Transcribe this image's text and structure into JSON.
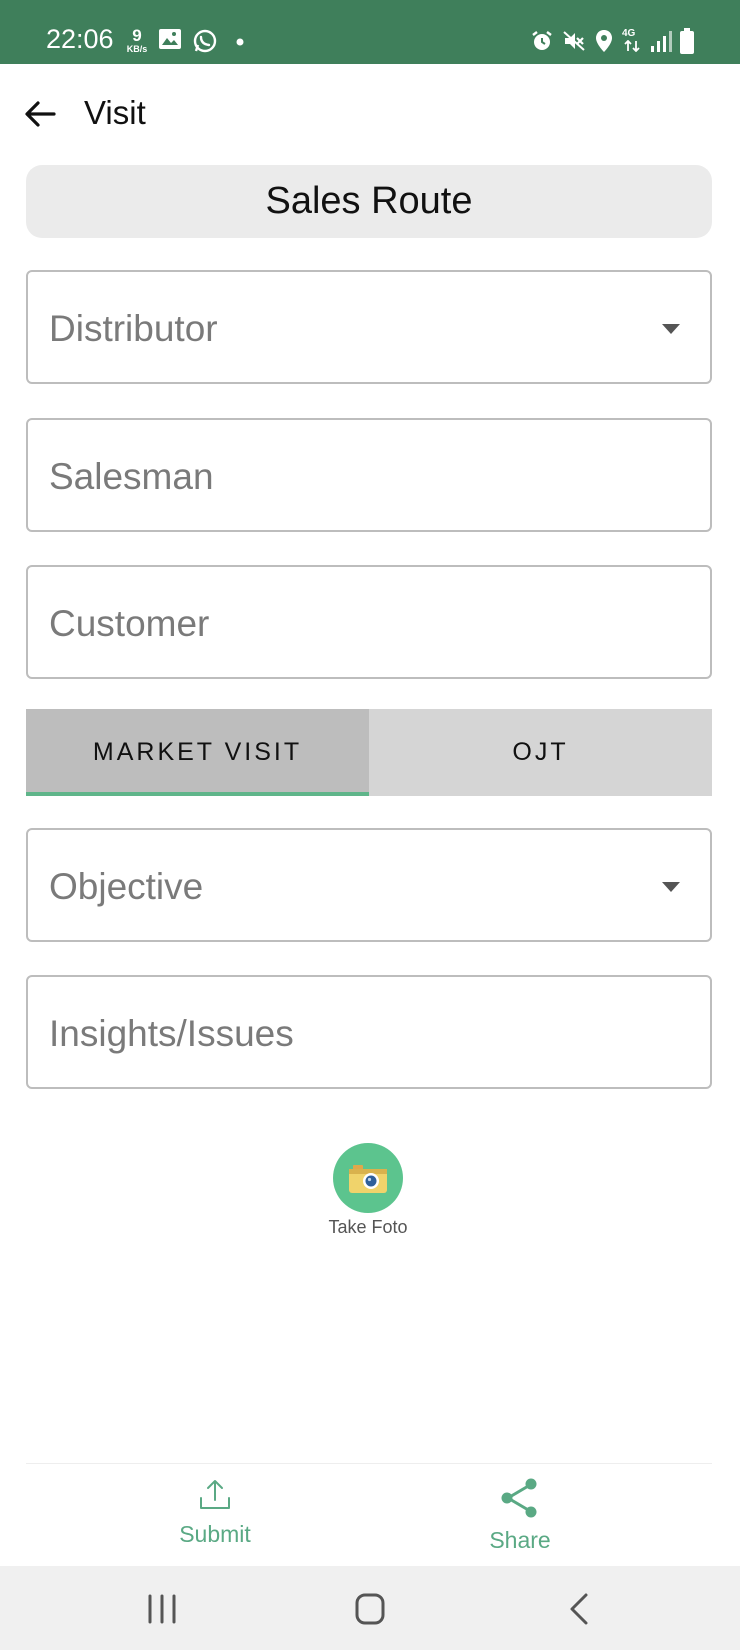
{
  "status_bar": {
    "time": "22:06",
    "net_speed_value": "9",
    "net_speed_unit": "KB/s",
    "network_type": "4G",
    "colors": {
      "background": "#3f7f5b"
    }
  },
  "app_bar": {
    "title": "Visit"
  },
  "route": {
    "title": "Sales Route"
  },
  "form": {
    "distributor": {
      "placeholder": "Distributor"
    },
    "salesman": {
      "placeholder": "Salesman"
    },
    "customer": {
      "placeholder": "Customer"
    },
    "objective": {
      "placeholder": "Objective"
    },
    "insights": {
      "placeholder": "Insights/Issues"
    }
  },
  "tabs": [
    {
      "label": "MARKET VISIT",
      "active": true
    },
    {
      "label": "OJT",
      "active": false
    }
  ],
  "take_foto": {
    "label": "Take Foto"
  },
  "actions": {
    "submit": {
      "label": "Submit",
      "icon": "upload-icon"
    },
    "share": {
      "label": "Share",
      "icon": "share-icon"
    }
  },
  "theme": {
    "accent": "#5aa984",
    "tab_indicator": "#5fb58a"
  }
}
